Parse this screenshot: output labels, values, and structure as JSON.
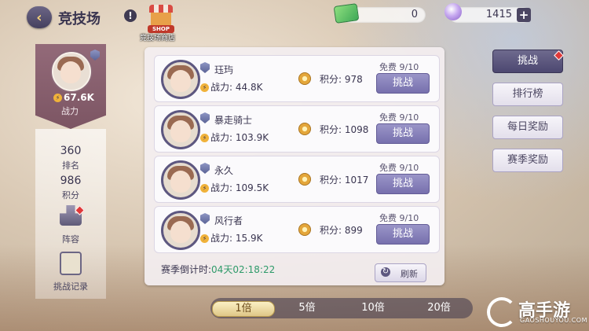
{
  "header": {
    "back_icon": "back-arrow-icon",
    "title": "竞技场",
    "shop_sign": "SHOP",
    "shop_label": "竞技场商店"
  },
  "resources": {
    "tickets": "0",
    "gems": "1415"
  },
  "player": {
    "power": "67.6K",
    "power_label": "战力",
    "rank": "360",
    "rank_label": "排名",
    "points": "986",
    "points_label": "积分",
    "lineup_label": "阵容",
    "record_label": "挑战记录"
  },
  "opponents": [
    {
      "name": "珏玙",
      "power": "战力: 44.8K",
      "score": "积分: 978",
      "free": "免费 9/10",
      "btn": "挑战"
    },
    {
      "name": "暴走骑士",
      "power": "战力: 103.9K",
      "score": "积分: 1098",
      "free": "免费 9/10",
      "btn": "挑战"
    },
    {
      "name": "永久",
      "power": "战力: 109.5K",
      "score": "积分: 1017",
      "free": "免费 9/10",
      "btn": "挑战"
    },
    {
      "name": "风行者",
      "power": "战力: 15.9K",
      "score": "积分: 899",
      "free": "免费 9/10",
      "btn": "挑战"
    }
  ],
  "season": {
    "label": "赛季倒计时:",
    "time": "04天02:18:22",
    "refresh": "刷新"
  },
  "right_menu": [
    "挑战",
    "排行榜",
    "每日奖励",
    "赛季奖励"
  ],
  "multipliers": [
    "1倍",
    "5倍",
    "10倍",
    "20倍"
  ],
  "watermark": {
    "brand": "高手游",
    "url": "GAOSHOUYOU.COM"
  }
}
